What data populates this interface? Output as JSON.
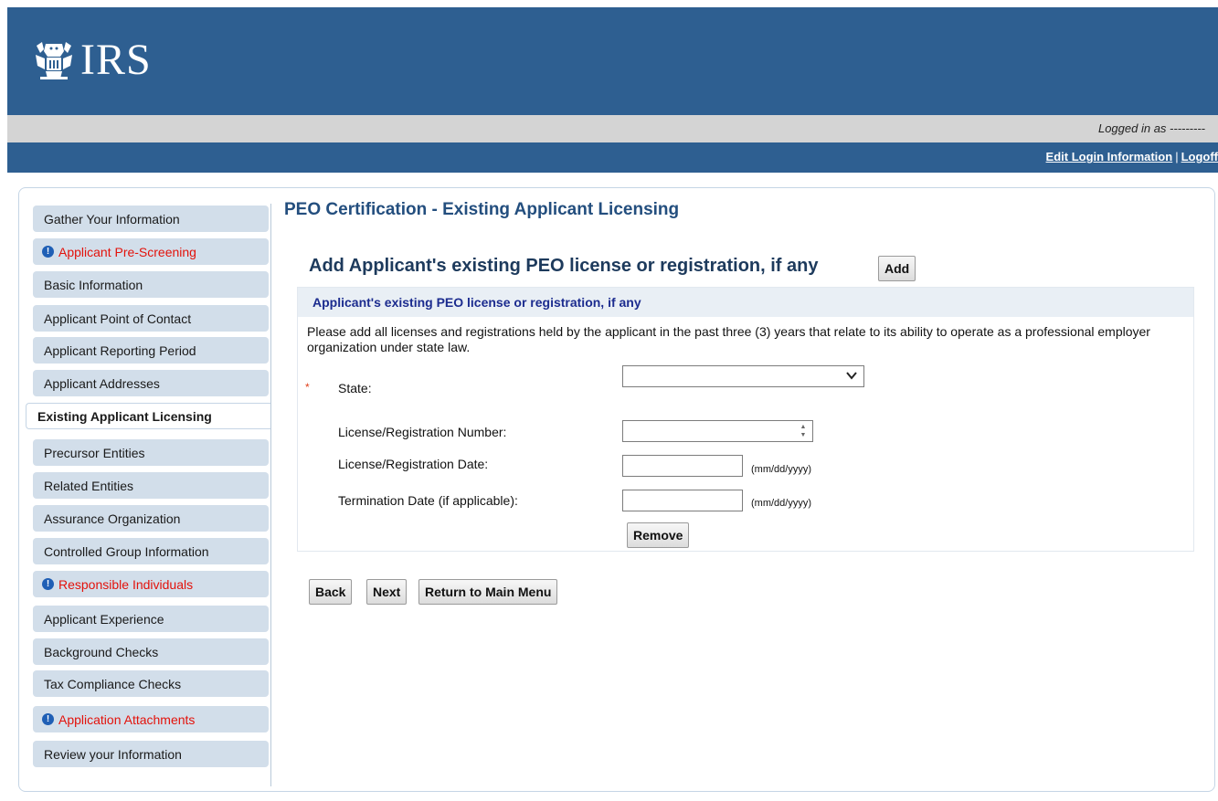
{
  "header": {
    "logo_text": "IRS",
    "logged_in_label": "Logged in as ---------",
    "edit_login_label": "Edit Login Information",
    "separator": "|",
    "logoff_label": "Logoff"
  },
  "sidebar": {
    "items": [
      {
        "label": "Gather Your Information",
        "alert": false
      },
      {
        "label": "Applicant Pre-Screening",
        "alert": true
      },
      {
        "label": "Basic Information",
        "alert": false
      },
      {
        "label": "Applicant Point of Contact",
        "alert": false
      },
      {
        "label": "Applicant Reporting Period",
        "alert": false
      },
      {
        "label": "Applicant Addresses",
        "alert": false
      },
      {
        "label": "Existing Applicant Licensing",
        "alert": false,
        "active": true
      },
      {
        "label": "Precursor Entities",
        "alert": false
      },
      {
        "label": "Related Entities",
        "alert": false
      },
      {
        "label": "Assurance Organization",
        "alert": false
      },
      {
        "label": "Controlled Group Information",
        "alert": false
      },
      {
        "label": "Responsible Individuals",
        "alert": true
      },
      {
        "label": "Applicant Experience",
        "alert": false
      },
      {
        "label": "Background Checks",
        "alert": false
      },
      {
        "label": "Tax Compliance Checks",
        "alert": false
      },
      {
        "label": "Application Attachments",
        "alert": true
      },
      {
        "label": "Review your Information",
        "alert": false
      }
    ]
  },
  "main": {
    "page_title": "PEO Certification - Existing Applicant Licensing",
    "section_title": "Add Applicant's existing PEO license or registration, if any",
    "add_button": "Add",
    "panel": {
      "header": "Applicant's existing PEO license or registration, if any",
      "description": "Please add all licenses and registrations held by the applicant in the past three (3) years that relate to its ability to operate as a professional employer organization under state law.",
      "required_marker": "*",
      "state_label": "State:",
      "state_value": "",
      "license_number_label": "License/Registration Number:",
      "license_number_value": "",
      "license_date_label": "License/Registration Date:",
      "license_date_value": "",
      "license_date_hint": "(mm/dd/yyyy)",
      "termination_label": "Termination Date (if applicable):",
      "termination_value": "",
      "termination_hint": "(mm/dd/yyyy)",
      "remove_button": "Remove"
    },
    "nav": {
      "back": "Back",
      "next": "Next",
      "main_menu": "Return to Main Menu"
    }
  },
  "colors": {
    "header_blue": "#2e5f91",
    "sidebar_item": "#d2deea",
    "alert_red": "#e3120b",
    "title_blue": "#234e7e"
  },
  "icons": {
    "alert": "exclamation-circle-icon",
    "dropdown": "chevron-down-icon",
    "spinner": "spinner-arrows-icon",
    "logo": "irs-eagle-icon"
  }
}
